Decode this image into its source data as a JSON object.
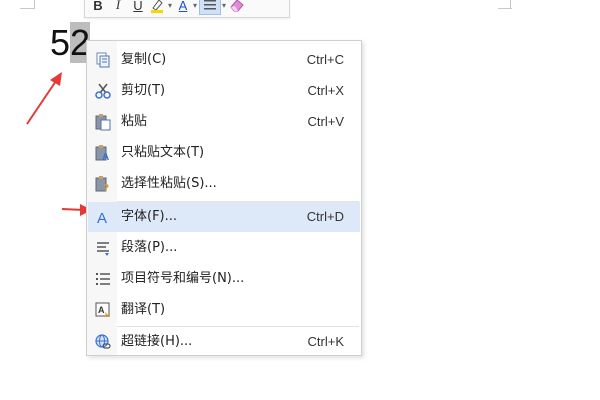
{
  "document": {
    "text_plain": "5",
    "text_selected": "2"
  },
  "mini_toolbar": {
    "bold": "B",
    "italic": "I",
    "underline": "U",
    "font_color": "A",
    "dropdown_arrow": "▾"
  },
  "context_menu": {
    "items": [
      {
        "label": "复制(C)",
        "shortcut": "Ctrl+C",
        "icon": "copy-icon"
      },
      {
        "label": "剪切(T)",
        "shortcut": "Ctrl+X",
        "icon": "scissors-icon"
      },
      {
        "label": "粘贴",
        "shortcut": "Ctrl+V",
        "icon": "paste-icon"
      },
      {
        "label": "只粘贴文本(T)",
        "shortcut": "",
        "icon": "paste-text-icon"
      },
      {
        "label": "选择性粘贴(S)...",
        "shortcut": "",
        "icon": "paste-special-icon"
      },
      {
        "label": "字体(F)...",
        "shortcut": "Ctrl+D",
        "icon": "font-icon",
        "highlighted": true
      },
      {
        "label": "段落(P)...",
        "shortcut": "",
        "icon": "paragraph-icon"
      },
      {
        "label": "项目符号和编号(N)...",
        "shortcut": "",
        "icon": "list-bullets-icon"
      },
      {
        "label": "翻译(T)",
        "shortcut": "",
        "icon": "translate-icon"
      },
      {
        "label": "超链接(H)...",
        "shortcut": "Ctrl+K",
        "icon": "hyperlink-icon"
      }
    ]
  },
  "colors": {
    "highlight": "#dde9f8",
    "arrow": "#e53935",
    "accent_blue": "#3b6fd6",
    "font_color_bar": "#1a4fd6",
    "highlighter_yellow": "#f5d800"
  }
}
